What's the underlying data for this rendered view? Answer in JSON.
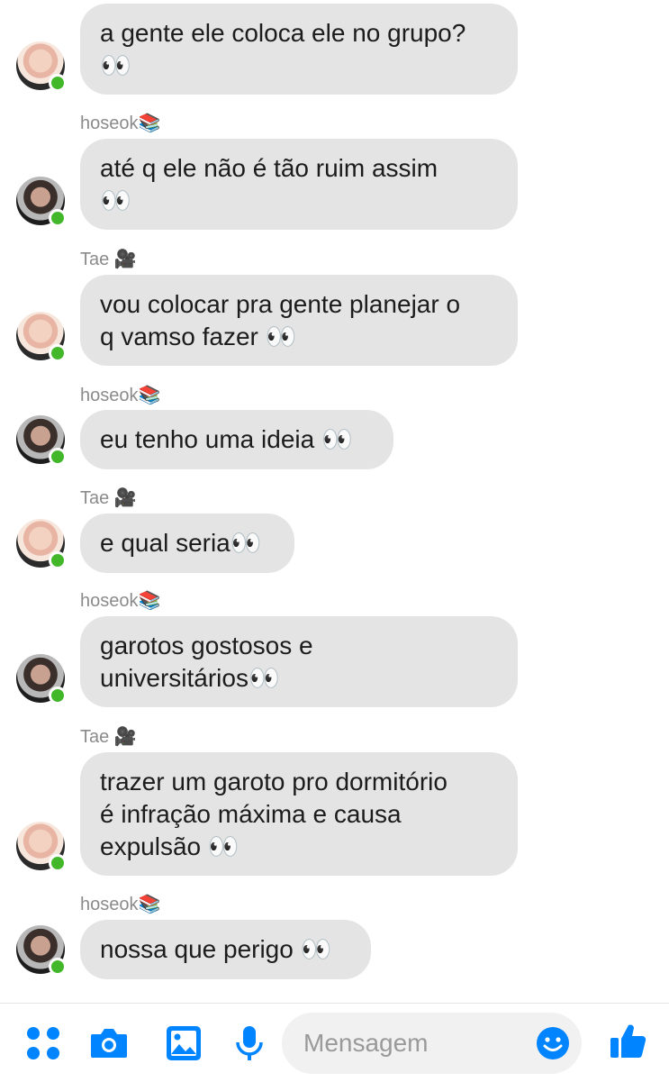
{
  "messages": [
    {
      "sender": "",
      "avatar": "tae",
      "lines": [
        "a gente ele coloca ele no grupo?",
        "👀"
      ]
    },
    {
      "sender": "hoseok📚",
      "avatar": "hoseok",
      "lines": [
        "até q ele não é tão ruim assim",
        "👀"
      ]
    },
    {
      "sender": "Tae 🎥",
      "avatar": "tae",
      "lines": [
        "vou colocar pra gente planejar o",
        "q vamso fazer 👀"
      ]
    },
    {
      "sender": "hoseok📚",
      "avatar": "hoseok",
      "lines": [
        "eu tenho uma ideia 👀"
      ]
    },
    {
      "sender": "Tae 🎥",
      "avatar": "tae",
      "lines": [
        "e qual seria👀"
      ]
    },
    {
      "sender": "hoseok📚",
      "avatar": "hoseok",
      "lines": [
        "garotos gostosos e",
        "universitários👀"
      ]
    },
    {
      "sender": "Tae 🎥",
      "avatar": "tae",
      "lines": [
        "trazer um garoto pro dormitório",
        "é infração máxima e causa",
        "expulsão 👀"
      ]
    },
    {
      "sender": "hoseok📚",
      "avatar": "hoseok",
      "lines": [
        "nossa que perigo 👀"
      ]
    }
  ],
  "composer": {
    "placeholder": "Mensagem",
    "icons": [
      "apps-icon",
      "camera-icon",
      "gallery-icon",
      "microphone-icon",
      "emoji-icon",
      "like-icon"
    ],
    "accent": "#0084ff"
  },
  "colors": {
    "bubble": "#e4e4e4",
    "online": "#42b72a"
  }
}
